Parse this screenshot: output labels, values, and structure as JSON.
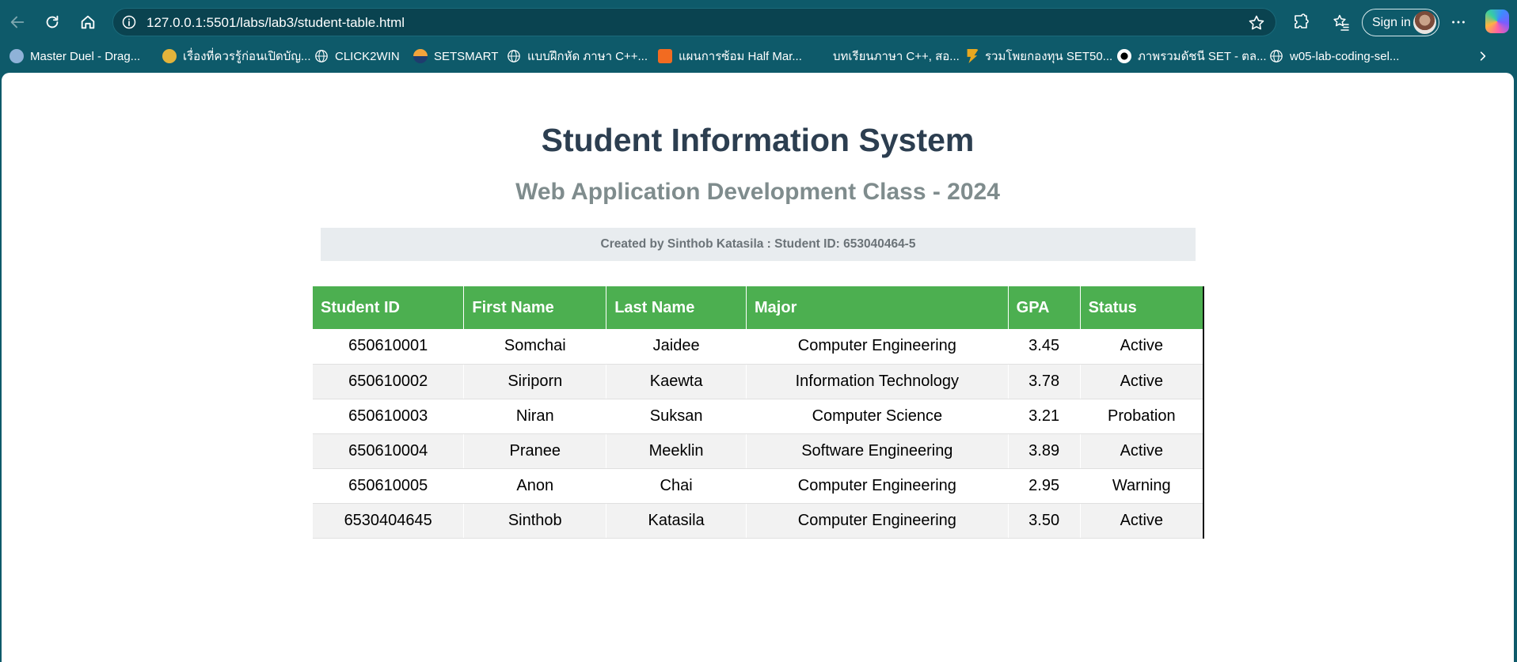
{
  "browser": {
    "url": "127.0.0.1:5501/labs/lab3/student-table.html",
    "signin_label": "Sign in",
    "bookmarks": [
      {
        "label": "Master Duel - Drag...",
        "icon": "game-icon"
      },
      {
        "label": "เรื่องที่ควรรู้ก่อนเปิดบัญ...",
        "icon": "bank-icon"
      },
      {
        "label": "CLICK2WIN",
        "icon": "globe-icon"
      },
      {
        "label": "SETSMART",
        "icon": "setsmart-icon"
      },
      {
        "label": "แบบฝึกหัด ภาษา C++...",
        "icon": "globe-icon"
      },
      {
        "label": "แผนการซ้อม Half Mar...",
        "icon": "orange-doc-icon"
      },
      {
        "label": "บทเรียนภาษา C++, สอ...",
        "icon": "blank-icon"
      },
      {
        "label": "รวมโพยกองทุน SET50...",
        "icon": "fund-icon"
      },
      {
        "label": "ภาพรวมดัชนี SET - ตล...",
        "icon": "set-index-icon"
      },
      {
        "label": "w05-lab-coding-sel...",
        "icon": "globe-icon"
      }
    ]
  },
  "page": {
    "title": "Student Information System",
    "subtitle": "Web Application Development Class - 2024",
    "creator": "Created by Sinthob Katasila : Student ID: 653040464-5"
  },
  "table": {
    "headers": [
      "Student ID",
      "First Name",
      "Last Name",
      "Major",
      "GPA",
      "Status"
    ],
    "rows": [
      {
        "id": "650610001",
        "first": "Somchai",
        "last": "Jaidee",
        "major": "Computer Engineering",
        "gpa": "3.45",
        "status": "Active"
      },
      {
        "id": "650610002",
        "first": "Siriporn",
        "last": "Kaewta",
        "major": "Information Technology",
        "gpa": "3.78",
        "status": "Active"
      },
      {
        "id": "650610003",
        "first": "Niran",
        "last": "Suksan",
        "major": "Computer Science",
        "gpa": "3.21",
        "status": "Probation"
      },
      {
        "id": "650610004",
        "first": "Pranee",
        "last": "Meeklin",
        "major": "Software Engineering",
        "gpa": "3.89",
        "status": "Active"
      },
      {
        "id": "650610005",
        "first": "Anon",
        "last": "Chai",
        "major": "Computer Engineering",
        "gpa": "2.95",
        "status": "Warning"
      },
      {
        "id": "6530404645",
        "first": "Sinthob",
        "last": "Katasila",
        "major": "Computer Engineering",
        "gpa": "3.50",
        "status": "Active"
      }
    ]
  },
  "colors": {
    "header_green": "#4caf50",
    "active": "#4caf50",
    "probation": "#f44336",
    "warning": "#ff9800",
    "title": "#2c3e50",
    "subtitle": "#7f8c8d",
    "browser_frame": "#0e5a6a"
  }
}
